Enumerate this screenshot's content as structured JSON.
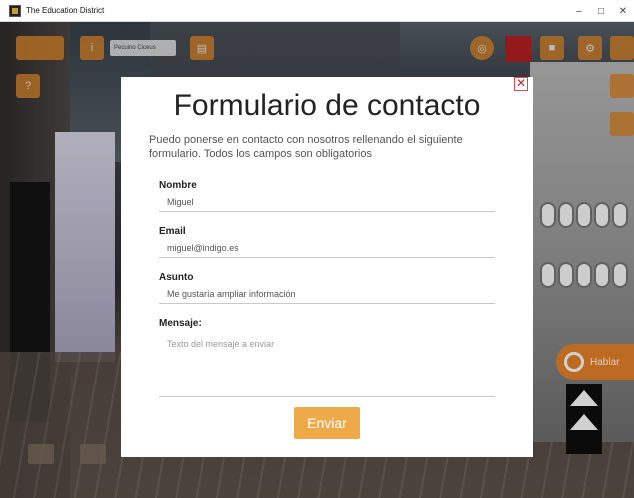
{
  "window": {
    "title": "The Education District",
    "controls": {
      "minimize": "–",
      "maximize": "□",
      "close": "✕"
    }
  },
  "hud": {
    "field_text": "Pecuino Ciceus"
  },
  "modal": {
    "title": "Formulario de contacto",
    "description": "Puedo ponerse en contacto con nosotros rellenando el siguiente formulario. Todos los campos son obligatorios",
    "fields": {
      "nombre": {
        "label": "Nombre",
        "value": "Miguel"
      },
      "email": {
        "label": "Email",
        "value": "miguel@indigo.es"
      },
      "asunto": {
        "label": "Asunto",
        "value": "Me gustaría ampliar información"
      },
      "mensaje": {
        "label": "Mensaje:",
        "placeholder": "Texto del mensaje a enviar"
      }
    },
    "submit_label": "Enviar",
    "close_symbol": "✕"
  },
  "talk_button": {
    "label": "Hablar"
  },
  "colors": {
    "accent": "#eeaa48",
    "hud_orange": "#d6852a",
    "close_red": "#d02525"
  }
}
